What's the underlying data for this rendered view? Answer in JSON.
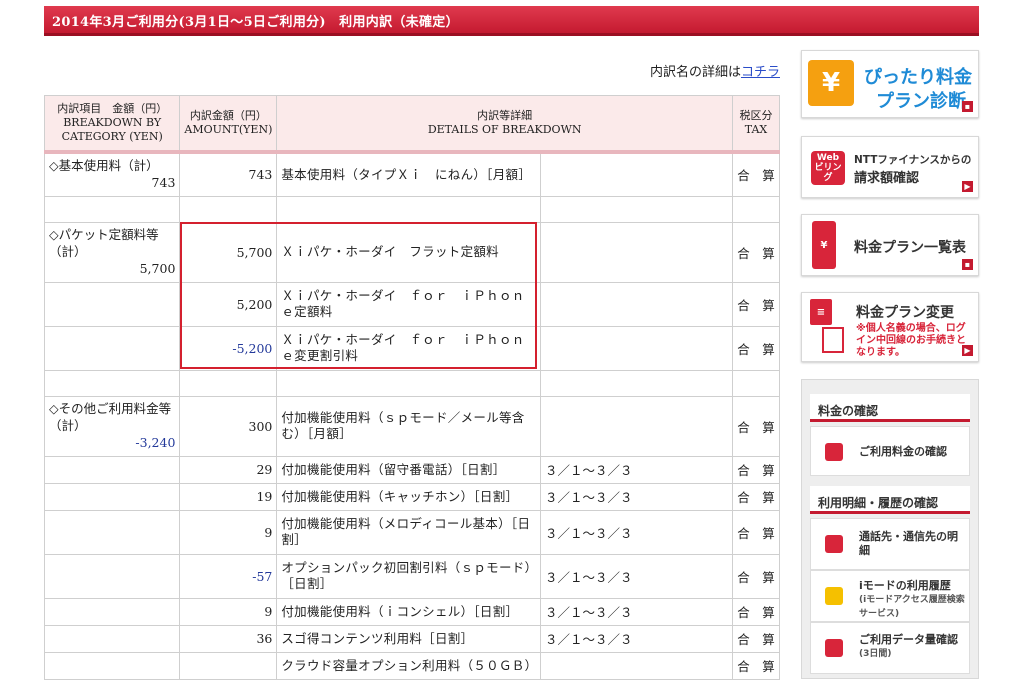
{
  "header": {
    "title": "2014年3月ご利用分(3月1日〜5日ご利用分)　利用内訳（未確定）"
  },
  "note": {
    "text": "内訳名の詳細は",
    "link": "コチラ"
  },
  "table": {
    "headers": {
      "category": [
        "内訳項目　金額（円）",
        "BREAKDOWN BY",
        "CATEGORY (YEN)"
      ],
      "amount": [
        "内訳金額（円）",
        "AMOUNT(YEN)"
      ],
      "details": [
        "内訳等詳細",
        "DETAILS OF BREAKDOWN"
      ],
      "tax": [
        "税区分",
        "TAX"
      ]
    },
    "rows": [
      {
        "category": "◇基本使用料（計）",
        "category_total": "743",
        "amount": "743",
        "desc": "基本使用料（タイプＸｉ　にねん）［月額］",
        "period": "",
        "tax": "合　算",
        "sep": true
      },
      {
        "blank": true
      },
      {
        "category": "◇パケット定額料等（計）",
        "category_total": "5,700",
        "amount": "5,700",
        "desc": "Ｘｉパケ・ホーダイ　フラット定額料",
        "period": "",
        "tax": "合　算"
      },
      {
        "amount": "5,200",
        "desc": "Ｘｉパケ・ホーダイ　ｆｏｒ　ｉＰｈｏｎｅ定額料",
        "period": "",
        "tax": "合　算"
      },
      {
        "amount": "-5,200",
        "negative": true,
        "desc": "Ｘｉパケ・ホーダイ　ｆｏｒ　ｉＰｈｏｎｅ変更割引料",
        "period": "",
        "tax": "合　算"
      },
      {
        "blank": true
      },
      {
        "category": "◇その他ご利用料金等（計）",
        "category_total": "-3,240",
        "cat_neg": true,
        "amount": "300",
        "desc": "付加機能使用料（ｓｐモード／メール等含む）［月額］",
        "period": "",
        "tax": "合　算"
      },
      {
        "amount": "29",
        "desc": "付加機能使用料（留守番電話）［日割］",
        "period": "３／１〜３／３",
        "tax": "合　算"
      },
      {
        "amount": "19",
        "desc": "付加機能使用料（キャッチホン）［日割］",
        "period": "３／１〜３／３",
        "tax": "合　算"
      },
      {
        "amount": "9",
        "desc": "付加機能使用料（メロディコール基本）［日割］",
        "period": "３／１〜３／３",
        "tax": "合　算"
      },
      {
        "amount": "-57",
        "negative": true,
        "desc": "オプションパック初回割引料（ｓｐモード）［日割］",
        "period": "３／１〜３／３",
        "tax": "合　算"
      },
      {
        "amount": "9",
        "desc": "付加機能使用料（ｉコンシェル）［日割］",
        "period": "３／１〜３／３",
        "tax": "合　算"
      },
      {
        "amount": "36",
        "desc": "スゴ得コンテンツ利用料［日割］",
        "period": "３／１〜３／３",
        "tax": "合　算"
      },
      {
        "amount": "",
        "desc": "クラウド容量オプション利用料（５０ＧＢ）",
        "period": "",
        "tax": "合　算"
      }
    ]
  },
  "sidebar": {
    "banner1": {
      "icon": "¥",
      "line1": "ぴったり料金",
      "line2": "プラン診断"
    },
    "banner2": {
      "icon": "Web ビリング",
      "line1": "NTTファイナンスからの",
      "line2": "請求額確認"
    },
    "banner3": {
      "icon": "¥",
      "line1": "料金プラン一覧表"
    },
    "banner4": {
      "line1": "料金プラン変更",
      "line2": "※個人名義の場合、ログイン中回線のお手続きとなります。"
    },
    "panel": {
      "section1": "料金の確認",
      "item1": "ご利用料金の確認",
      "section2": "利用明細・履歴の確認",
      "item2": "通話先・通信先の明細",
      "item3": "iモードの利用履歴",
      "item3_sub": "(iモードアクセス履歴検索サービス)",
      "item4": "ご利用データ量確認",
      "item4_sub": "(3日間)"
    }
  },
  "colors": {
    "accent": "#c41a30",
    "link": "#2a4cc8",
    "negative": "#23399a"
  }
}
